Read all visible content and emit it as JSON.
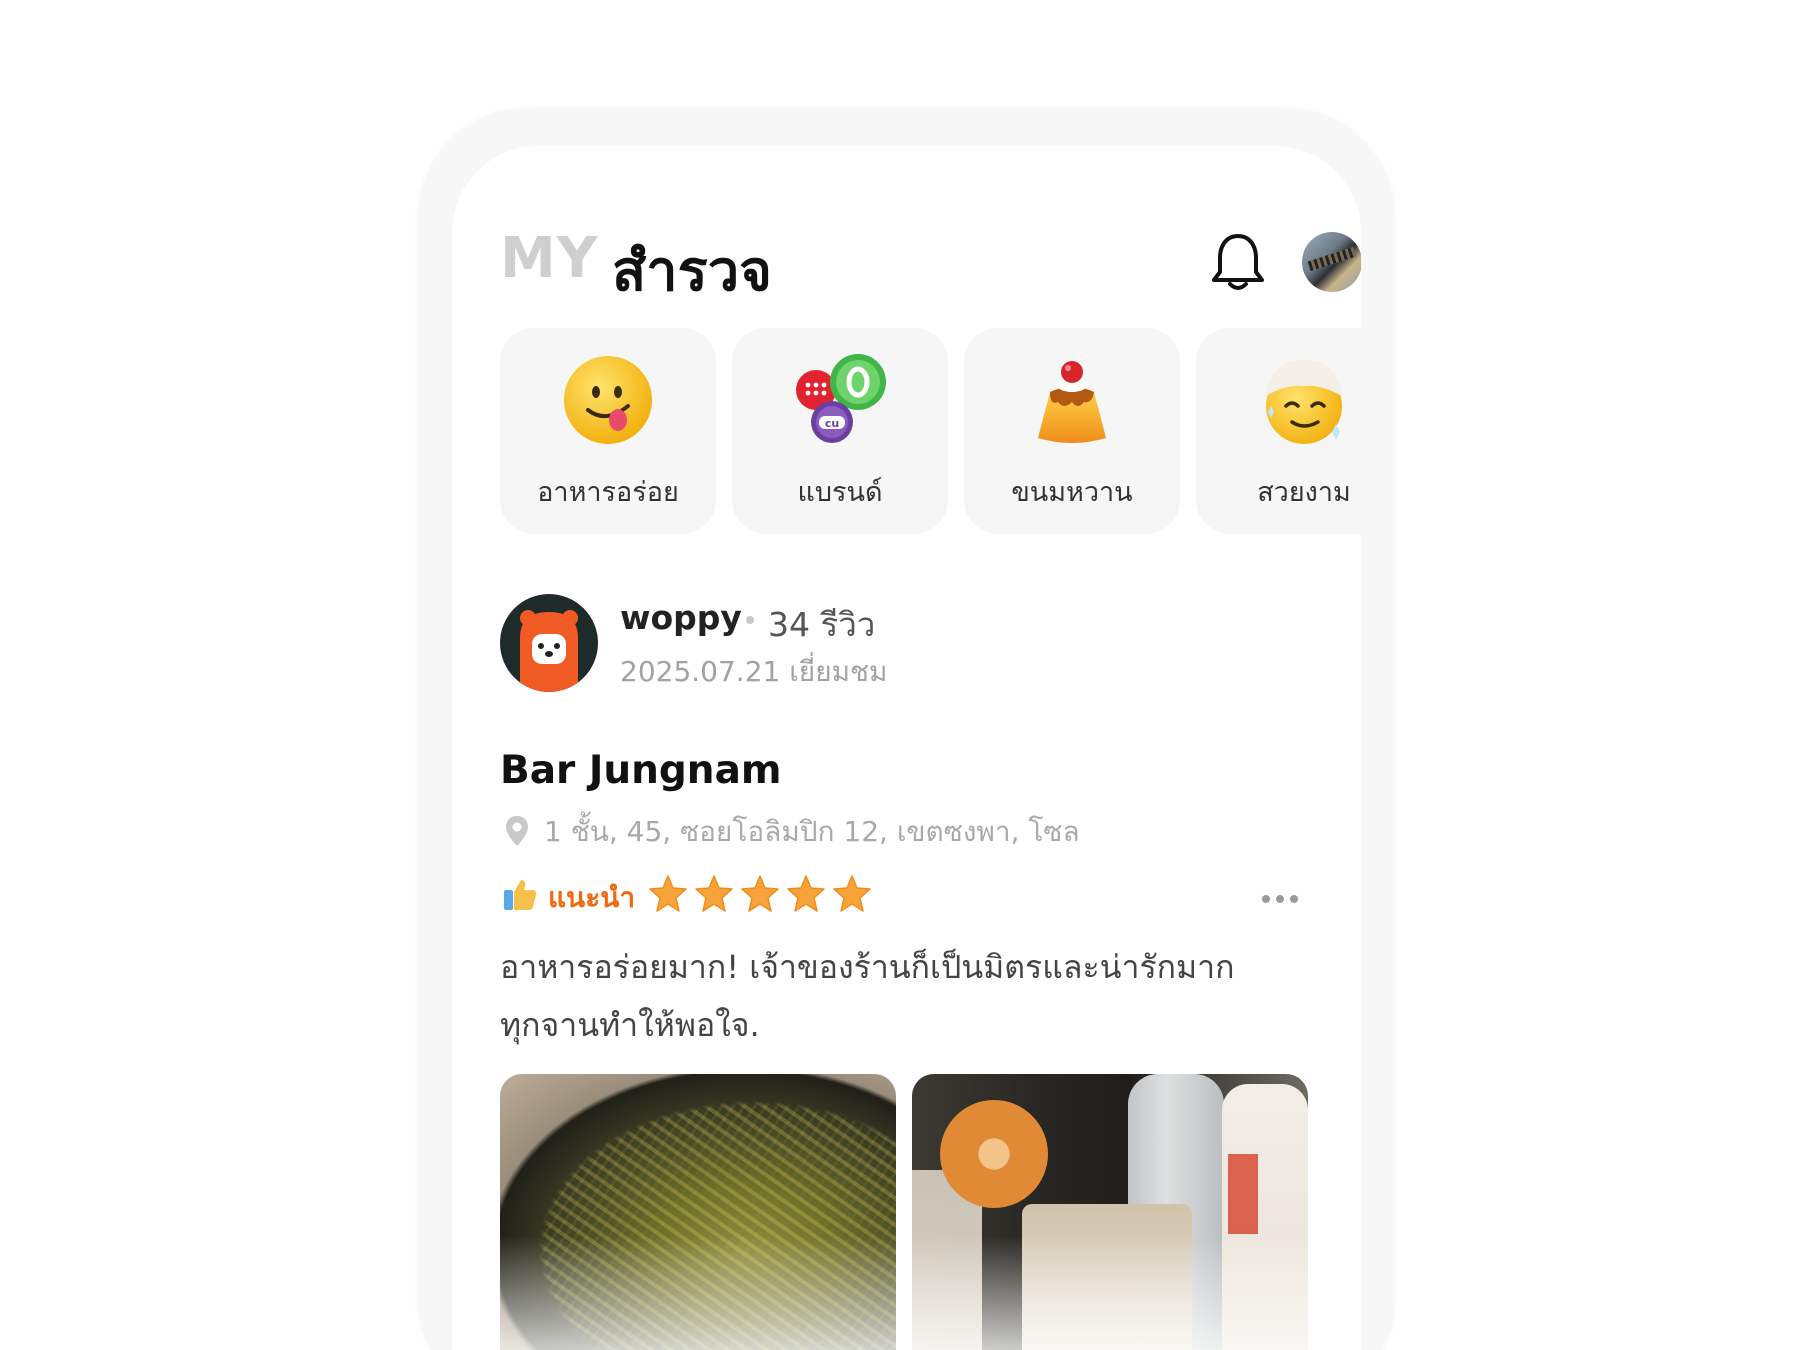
{
  "header": {
    "tab_my": "MY",
    "tab_explore": "สำรวจ"
  },
  "categories": [
    {
      "label": "อาหารอร่อย",
      "icon": "yummy-face-icon"
    },
    {
      "label": "แบรนด์",
      "icon": "brand-logos-icon"
    },
    {
      "label": "ขนมหวาน",
      "icon": "pudding-icon"
    },
    {
      "label": "สวยงาม",
      "icon": "relaxed-face-icon"
    }
  ],
  "review": {
    "author": "woppy",
    "review_count": "34 รีวิว",
    "visit_date": "2025.07.21 เยี่ยมชม",
    "place_name": "Bar Jungnam",
    "address": "1 ชั้น, 45, ซอยโอลิมปิก 12, เขตซงพา, โซล",
    "recommend_label": "แนะนำ",
    "rating": 5,
    "body": "อาหารอร่อยมาก! เจ้าของร้านก็เป็นมิตรและน่ารักมาก ทุกจานทำให้พอใจ."
  },
  "brand_badge_text": "cu",
  "colors": {
    "accent": "#f06a12",
    "star": "#f7a23b",
    "muted": "#a9a9a9"
  }
}
